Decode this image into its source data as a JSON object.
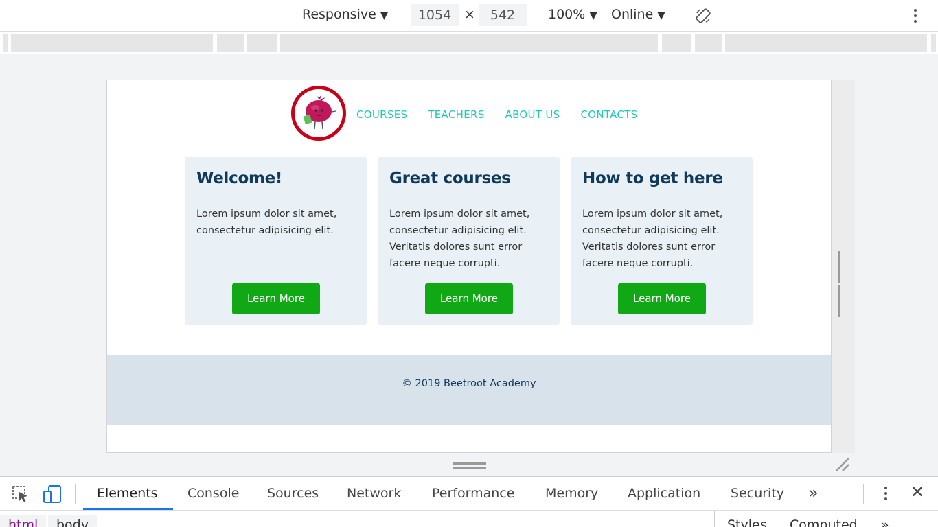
{
  "device_toolbar": {
    "device": "Responsive",
    "width": "1054",
    "times": "×",
    "height": "542",
    "zoom": "100%",
    "network": "Online"
  },
  "site": {
    "nav": [
      "COURSES",
      "TEACHERS",
      "ABOUT US",
      "CONTACTS"
    ],
    "cards": [
      {
        "title": "Welcome!",
        "text": "Lorem ipsum dolor sit amet, consectetur adipisicing elit.",
        "button": "Learn More"
      },
      {
        "title": "Great courses",
        "text": "Lorem ipsum dolor sit amet, consectetur adipisicing elit. Veritatis dolores sunt error facere neque corrupti.",
        "button": "Learn More"
      },
      {
        "title": "How to get here",
        "text": "Lorem ipsum dolor sit amet, consectetur adipisicing elit. Veritatis dolores sunt error facere neque corrupti.",
        "button": "Learn More"
      }
    ],
    "footer": "© 2019 Beetroot Academy",
    "colors": {
      "nav": "#1fc9b7",
      "heading": "#0f3a5c",
      "button": "#10a915",
      "card_bg": "#eaf1f6",
      "footer_bg": "#d7e2ea",
      "logo_ring": "#c8001a"
    }
  },
  "devtools": {
    "tabs": [
      "Elements",
      "Console",
      "Sources",
      "Network",
      "Performance",
      "Memory",
      "Application",
      "Security"
    ],
    "active_tab": "Elements",
    "more": "»",
    "close": "✕",
    "breadcrumbs": [
      "html",
      "body"
    ],
    "side_tabs": [
      "Styles",
      "Computed"
    ],
    "side_more": "»"
  }
}
